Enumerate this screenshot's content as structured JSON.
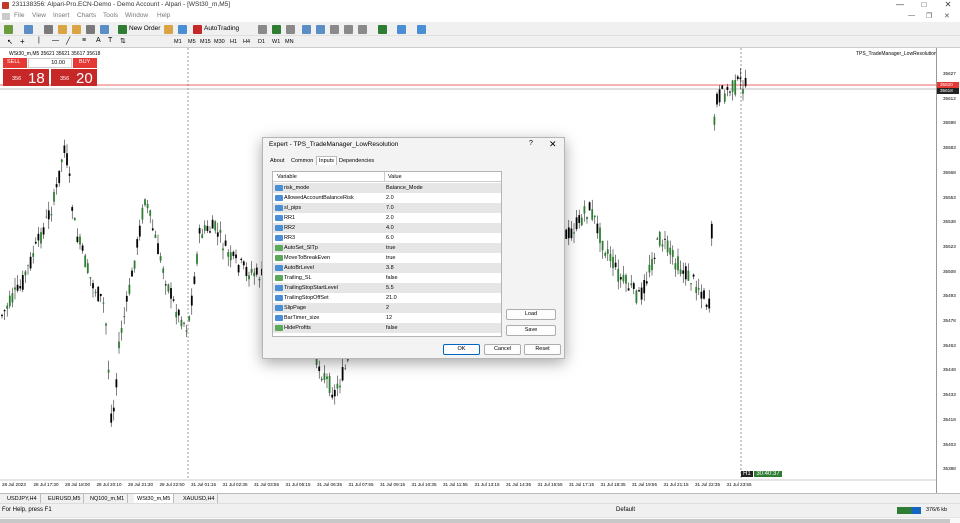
{
  "window": {
    "title": "231138356: Alpari-Pro.ECN-Demo - Demo Account - Alpari - [WSt30_m,M5]",
    "controls": [
      "—",
      "□",
      "✕"
    ]
  },
  "menu": {
    "items": [
      "File",
      "View",
      "Insert",
      "Charts",
      "Tools",
      "Window",
      "Help"
    ],
    "right_controls": [
      "—",
      "❐",
      "✕"
    ]
  },
  "toolbar": {
    "new_order_label": "New Order",
    "autotrading_label": "AutoTrading",
    "timeframes": [
      "M1",
      "M5",
      "M15",
      "M30",
      "H1",
      "H4",
      "D1",
      "W1",
      "MN"
    ]
  },
  "chart": {
    "symbol_line": "WSt30_m,M5  35621 35621 35617 35618",
    "ea_name": "TPS_TradeManager_LowResolution",
    "trade_panel": {
      "sell_label": "SELL",
      "buy_label": "BUY",
      "lot": "10.00",
      "sell_prefix": "356",
      "sell_big": "18",
      "buy_prefix": "356",
      "buy_big": "20"
    },
    "price_labels": [
      "35627",
      "35612",
      "35598",
      "35583",
      "35568",
      "35553",
      "35538",
      "35523",
      "35508",
      "35493",
      "35478",
      "35463",
      "35448",
      "35433",
      "35418",
      "35403",
      "35388"
    ],
    "current_ask": "35620",
    "current_bid": "35618",
    "time_labels": [
      "28 Jul 2023",
      "28 Jul 17:30",
      "28 Jul 18:00",
      "28 Jul 20:10",
      "28 Jul 21:30",
      "28 Jul 22:50",
      "31 Jul 01:15",
      "31 Jul 02:35",
      "31 Jul 03:55",
      "31 Jul 05:15",
      "31 Jul 06:35",
      "31 Jul 07:55",
      "31 Jul 09:15",
      "31 Jul 10:35",
      "31 Jul 11:55",
      "31 Jul 13:15",
      "31 Jul 14:35",
      "31 Jul 15:55",
      "31 Jul 17:15",
      "31 Jul 18:35",
      "31 Jul 19:55",
      "31 Jul 21:15",
      "31 Jul 22:35",
      "31 Jul 23:55"
    ],
    "countdown_prefix": "H1",
    "countdown": "30:40:37",
    "colors": {
      "bull": "#2e7d32",
      "bear": "#000000",
      "ask_line": "#e53935",
      "bid_line": "#aaaaaa"
    }
  },
  "tabs": {
    "items": [
      "USDJPY,H4",
      "EURUSD,M5",
      "NQ100_m,M1",
      "WSt30_m,M5",
      "XAUUSD,H4"
    ],
    "active": "WSt30_m,M5"
  },
  "status": {
    "help": "For Help, press F1",
    "profile": "Default",
    "traffic": "376/6 kb"
  },
  "dialog": {
    "title": "Expert - TPS_TradeManager_LowResolution",
    "help": "?",
    "close": "✕",
    "tabs": [
      "About",
      "Common",
      "Inputs",
      "Dependencies"
    ],
    "active_tab": "Inputs",
    "col_variable": "Variable",
    "col_value": "Value",
    "rows": [
      {
        "name": "risk_mode",
        "value": "Balance_Mode",
        "icon": "blue"
      },
      {
        "name": "AllowedAccountBalanceRisk",
        "value": "2.0",
        "icon": "blue"
      },
      {
        "name": "sl_pips",
        "value": "7.0",
        "icon": "blue"
      },
      {
        "name": "RR1",
        "value": "2.0",
        "icon": "blue"
      },
      {
        "name": "RR2",
        "value": "4.0",
        "icon": "blue"
      },
      {
        "name": "RR3",
        "value": "6.0",
        "icon": "blue"
      },
      {
        "name": "AutoSet_SlTp",
        "value": "true",
        "icon": "green"
      },
      {
        "name": "MoveToBreakEven",
        "value": "true",
        "icon": "green"
      },
      {
        "name": "AutoBrLevel",
        "value": "3.8",
        "icon": "blue"
      },
      {
        "name": "Trailing_SL",
        "value": "false",
        "icon": "green"
      },
      {
        "name": "TrailingStopStartLevel",
        "value": "5.5",
        "icon": "blue"
      },
      {
        "name": "TrailingStopOffSet",
        "value": "21.0",
        "icon": "blue"
      },
      {
        "name": "SlipPage",
        "value": "2",
        "icon": "blue"
      },
      {
        "name": "BarTimer_size",
        "value": "12",
        "icon": "blue"
      },
      {
        "name": "HideProfits",
        "value": "false",
        "icon": "green"
      }
    ],
    "load_label": "Load",
    "save_label": "Save",
    "ok_label": "OK",
    "cancel_label": "Cancel",
    "reset_label": "Reset"
  }
}
